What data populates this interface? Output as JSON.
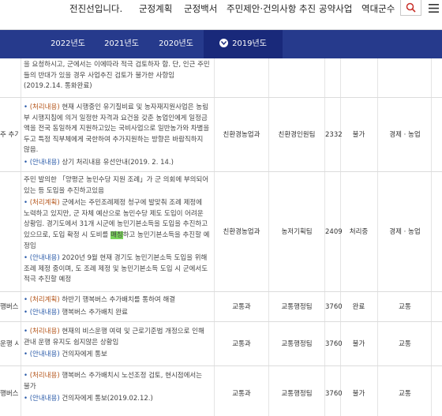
{
  "top_nav": {
    "items": [
      "전진선입니다.",
      "군정계획",
      "군정백서",
      "주민제안·건의사항 추진",
      "공약사업",
      "역대군수"
    ]
  },
  "icons": {
    "search": "search-icon",
    "menu": "hamburger-icon"
  },
  "year_tabs": {
    "tabs": [
      "2022년도",
      "2021년도",
      "2020년도",
      "2019년도"
    ],
    "active_index": 3
  },
  "colors": {
    "year_bar": "#263a8c",
    "active_tab": "#19297a",
    "label_orange": "#b4551a",
    "label_blue": "#2a5aa8",
    "highlight": "#7ad45a"
  },
  "rows": [
    {
      "sub": "",
      "lines": [
        {
          "label": "",
          "text": "을 요청하시고, 군에서는 이에따라 적극 검토하자 함. 단, 인근 주민들의 반대가 있을 경우 사업추진 검토가 불가한 사항임(2019.2.14. 통화완료)"
        }
      ],
      "dept": "",
      "team": "",
      "num": "",
      "status": "",
      "field": ""
    },
    {
      "sub": "주 추가",
      "lines": [
        {
          "label": "(처리내용)",
          "text": " 현재 시행중인 유기질비료 및 농자재지원사업은 농림부 시행지침에 의거 일정한 자격과 요건을 갖춘 농업인에게 일정금액을 전국 동일하게 지원하고있는 국비사업으로 일반농가와 차별을 두고 특정 직부체에게 국한하여 추가지원하는 방향은 바람직하지 않음."
        },
        {
          "label": "(안내내용)",
          "text": " 상기 처리내용 유선안내(2019. 2. 14.)"
        }
      ],
      "dept": "친환경농업과",
      "team": "친환경인원팀",
      "num": "2332",
      "status": "불가",
      "field": "경제 · 농업"
    },
    {
      "sub": "",
      "lines": [
        {
          "label": "",
          "text": "주민 발의한 「양평군 농민수당 지원 조례」가 군 의회에 부의되어있는 등 도입을 추진하고있음"
        },
        {
          "label": "(처리계획)",
          "text": " 군에서는 주민조례제정 청구에 발맞춰 조례 제정에 노력하고 있지만, 군 자체 예산으로 농민수당 제도 도입이 어려운 상황임. 경기도에서 31개 시군에 농민기본소득을 도입을 추진하고 있으므로, 도입 확정 시 도비를 ",
          "highlight": "매칭",
          "tail": "하고 농민기본소득을 추진할 예정임"
        },
        {
          "label": "(안내내용)",
          "text": " 2020년 9월 현재 경기도 농민기본소득 도입을 위해 조례 제정 중이며, 도 조례 제정 및 농민기본소득 도입 시 군에서도 적극 추진할 예정"
        }
      ],
      "dept": "친환경농업과",
      "team": "농저기획팀",
      "num": "2409",
      "status": "처리중",
      "field": "경제 · 농업"
    },
    {
      "sub": "행버스",
      "lines": [
        {
          "label": "(처리계획)",
          "text": " 하반기 행복버스 추가배치를 통하여 해결"
        },
        {
          "label": "(안내내용)",
          "text": " 행복버스 추가배치 완료"
        }
      ],
      "dept": "교통과",
      "team": "교통행정팀",
      "num": "3760",
      "status": "완료",
      "field": "교통"
    },
    {
      "sub": "운행 시",
      "lines": [
        {
          "label": "(처리내용)",
          "text": " 현재의 비스운행 여력 및 근로기준법 개정으로 인해 관내 운행 유지도 쉽지않은 상황임"
        },
        {
          "label": "(안내내용)",
          "text": " 건의자에게 통보"
        }
      ],
      "dept": "교통과",
      "team": "교통행정팀",
      "num": "3760",
      "status": "불가",
      "field": "교통"
    },
    {
      "sub": "행버스 구",
      "lines": [
        {
          "label": "(처리내용)",
          "text": " 행복버스 추가배치시 노선조정 검토, 현시점에서는 불가"
        },
        {
          "label": "(안내내용)",
          "text": " 건의자에게 통보(2019.02.12.)"
        }
      ],
      "dept": "교통과",
      "team": "교통행정팀",
      "num": "3760",
      "status": "불가",
      "field": "교통"
    }
  ]
}
